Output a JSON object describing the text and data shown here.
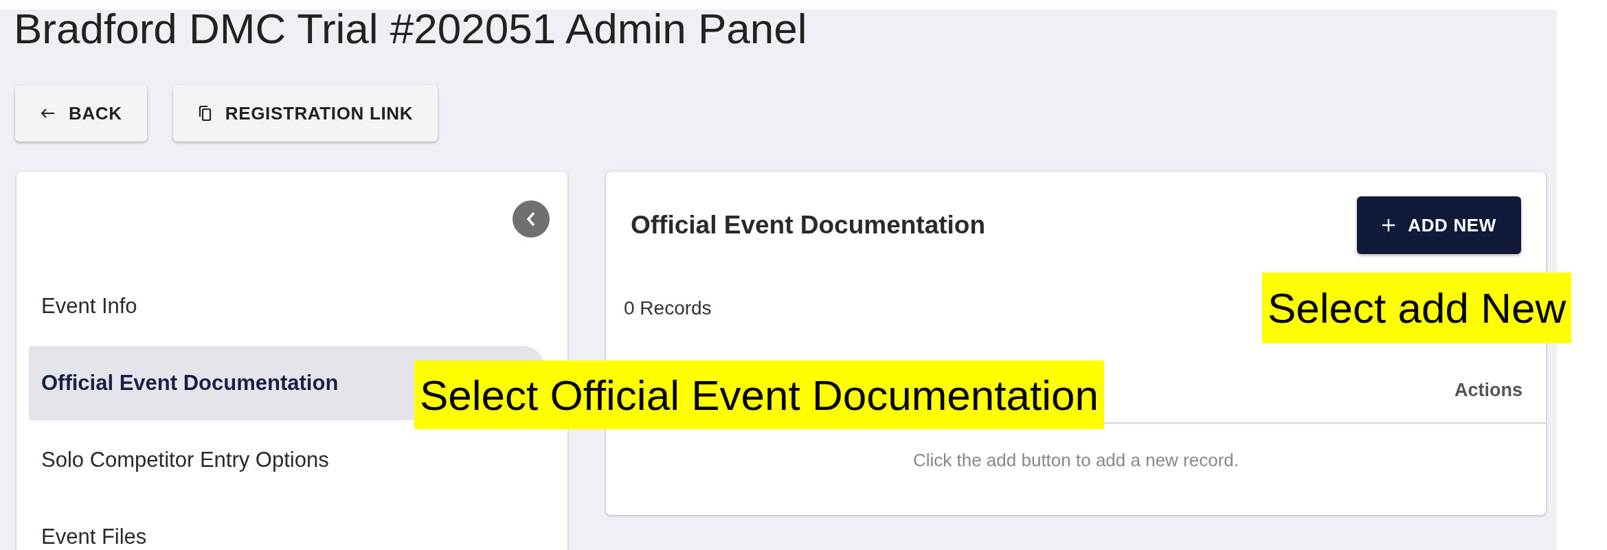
{
  "page": {
    "title": "Bradford DMC Trial #202051 Admin Panel"
  },
  "toolbar": [
    {
      "label": "BACK",
      "kind": "back"
    },
    {
      "label": "REGISTRATION LINK",
      "kind": "copy"
    }
  ],
  "sidebar": {
    "items": [
      {
        "label": "Event Info",
        "selected": false
      },
      {
        "label": "Official Event Documentation",
        "selected": true
      },
      {
        "label": "Solo Competitor Entry Options",
        "selected": false
      },
      {
        "label": "Event Files",
        "selected": false
      }
    ]
  },
  "panel": {
    "title": "Official Event Documentation",
    "add_button": "ADD NEW",
    "count": "0 Records",
    "columns": [
      "Actions"
    ],
    "empty_message": "Click the add button to add a new record."
  },
  "annotations": [
    {
      "text": "Select add New",
      "kind": "add"
    },
    {
      "text": "Select Official Event Documentation",
      "kind": "sidebar"
    }
  ]
}
